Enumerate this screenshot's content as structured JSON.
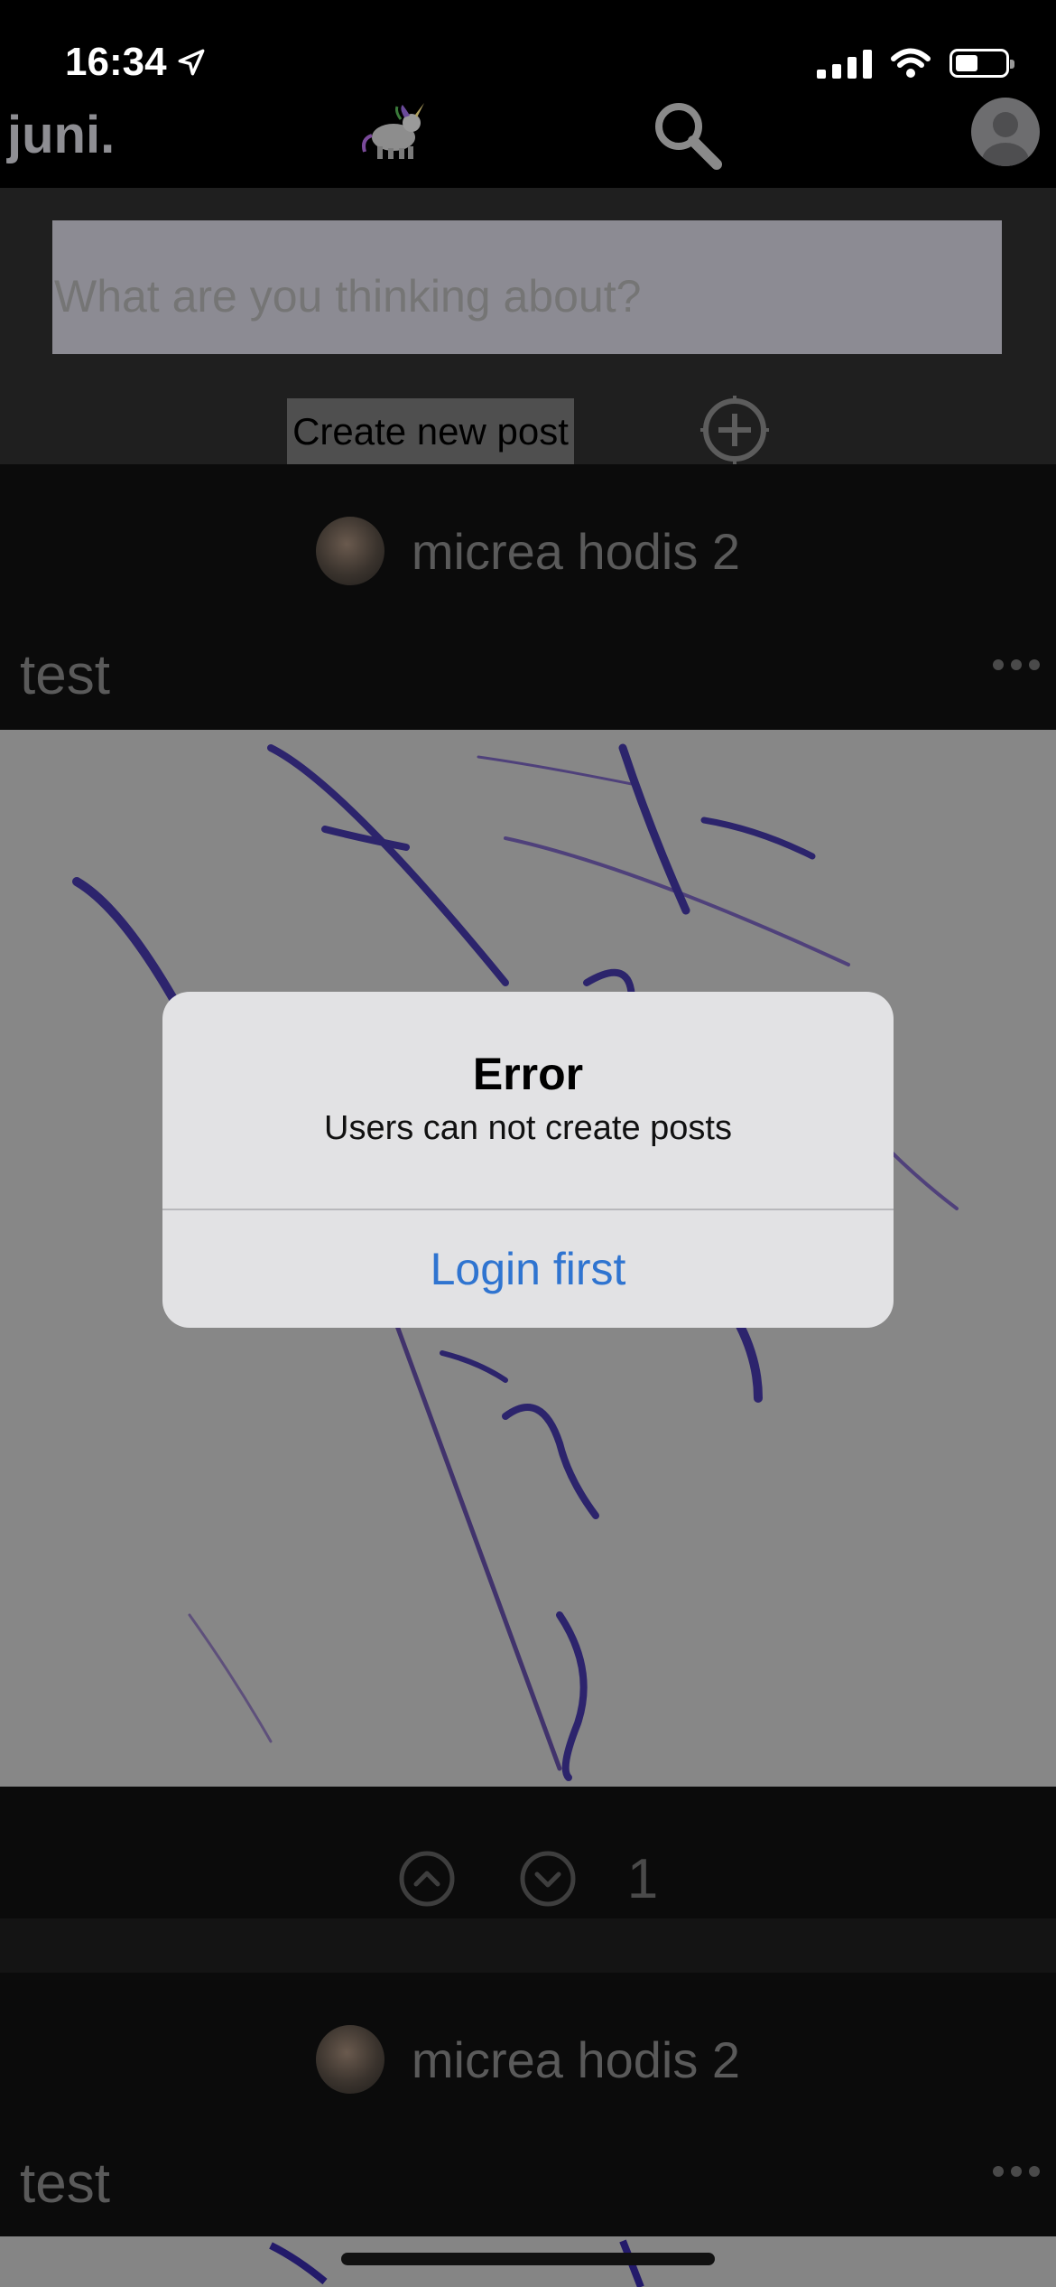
{
  "status_bar": {
    "time": "16:34",
    "icons": [
      "location-arrow-icon",
      "cellular-signal-icon",
      "wifi-icon",
      "battery-icon"
    ]
  },
  "header": {
    "brand": "juni.",
    "icons": [
      "unicorn-logo-icon",
      "search-icon",
      "profile-avatar-icon"
    ]
  },
  "composer": {
    "placeholder": "What are you thinking about?",
    "create_button": "Create new post",
    "add_icon": "plus-circle-icon"
  },
  "posts": [
    {
      "author": "micrea hodis 2",
      "title": "test",
      "votes": "1"
    },
    {
      "author": "micrea hodis 2",
      "title": "test"
    }
  ],
  "alert": {
    "title": "Error",
    "message": "Users can not create posts",
    "action": "Login first",
    "action_color": "#2F74D0"
  },
  "colors": {
    "background": "#000000",
    "dimmed_text": "#5A5A5A",
    "alert_bg": "#E2E2E4"
  }
}
